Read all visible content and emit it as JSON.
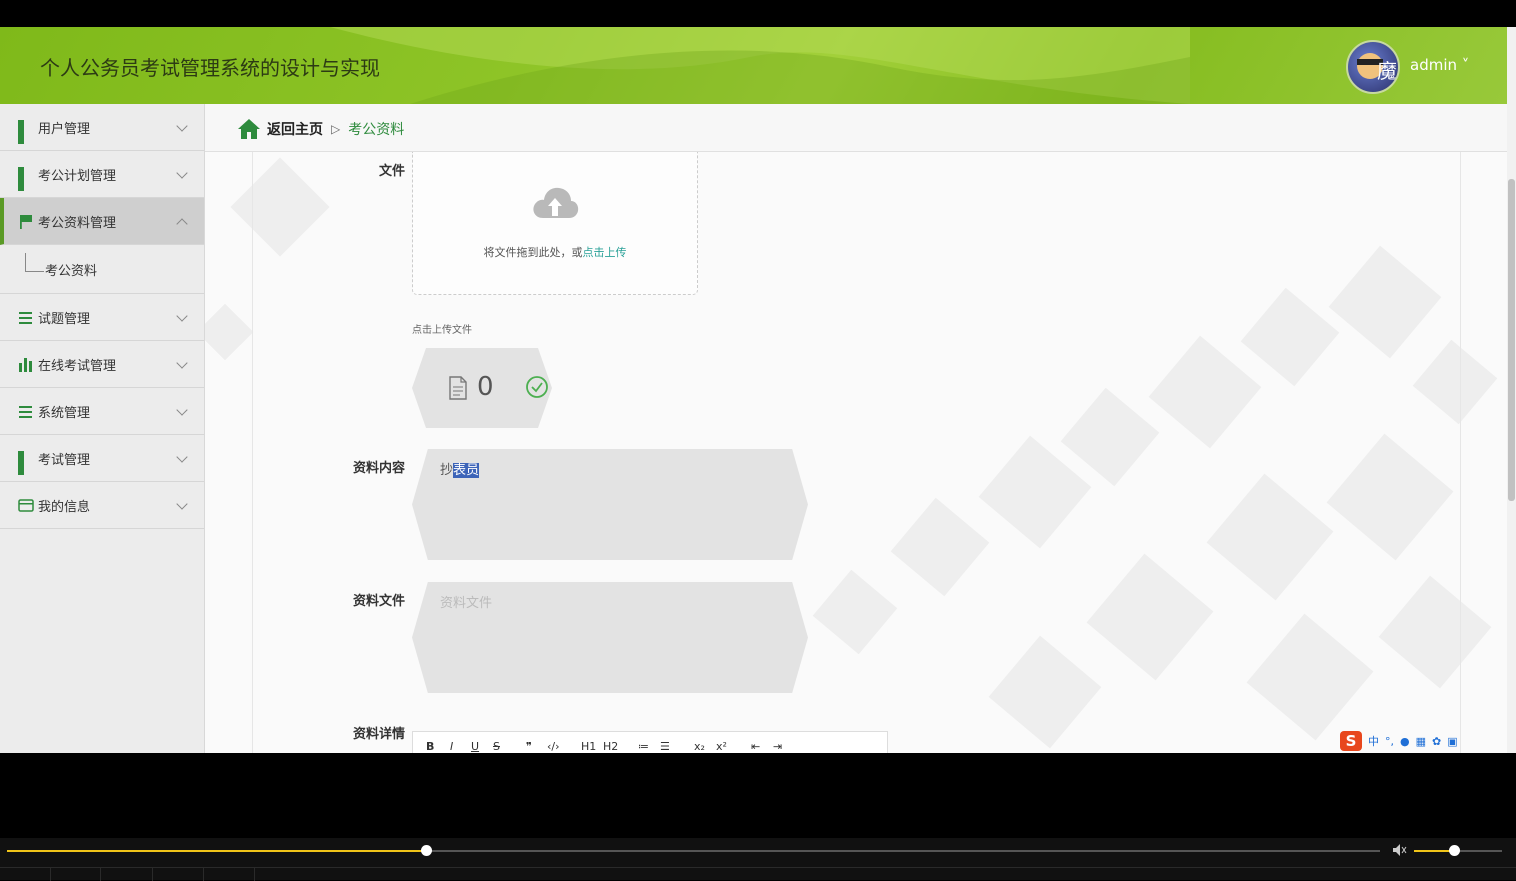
{
  "header": {
    "title": "个人公务员考试管理系统的设计与实现",
    "user": "admin ˅"
  },
  "sidebar": {
    "items": [
      {
        "label": "用户管理",
        "icon": "grid-icon"
      },
      {
        "label": "考公计划管理",
        "icon": "grid-icon"
      },
      {
        "label": "考公资料管理",
        "icon": "flag-icon",
        "open": true
      },
      {
        "label": "试题管理",
        "icon": "list-icon"
      },
      {
        "label": "在线考试管理",
        "icon": "bar-chart-icon"
      },
      {
        "label": "系统管理",
        "icon": "list-icon"
      },
      {
        "label": "考试管理",
        "icon": "grid-icon"
      },
      {
        "label": "我的信息",
        "icon": "card-icon"
      }
    ],
    "sub_items": [
      {
        "label": "考公资料"
      }
    ]
  },
  "breadcrumb": {
    "home": "返回主页",
    "separator": "▷",
    "current": "考公资料"
  },
  "form": {
    "file_label": "文件",
    "upload_text": "将文件拖到此处，或",
    "upload_link": "点击上传",
    "upload_hint": "点击上传文件",
    "file_count": "0",
    "content_label": "资料内容",
    "content_value_prefix": "抄",
    "content_value_selected": "表员",
    "file_field_label": "资料文件",
    "file_field_placeholder": "资料文件",
    "detail_label": "资料详情",
    "toolbar": [
      "B",
      "I",
      "U",
      "S",
      "❞",
      "‹/›",
      "H1",
      "H2",
      "≔",
      "☰",
      "x₂",
      "x²",
      "⇤",
      "⇥"
    ]
  },
  "ime": {
    "logo": "S",
    "mode": "中"
  },
  "colors": {
    "brand_green": "#8ec427",
    "accent_green": "#2e8b3d",
    "progress": "#f0c419"
  },
  "player": {
    "progress": 0.305,
    "volume": 0.45
  }
}
